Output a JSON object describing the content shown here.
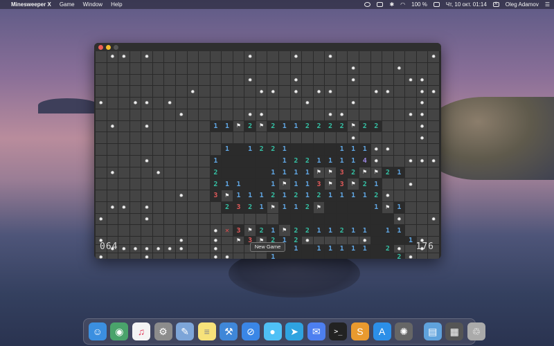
{
  "menubar": {
    "app": "Minesweeper X",
    "items": [
      "Game",
      "Window",
      "Help"
    ],
    "battery": "100 %",
    "datetime": "Чт, 10 окт.  01:14",
    "input_source": "A",
    "user": "Oleg Adamov"
  },
  "window": {
    "mines_left": "064",
    "new_game_label": "New Game",
    "timer": "176"
  },
  "board": {
    "legend": {
      ".": "hidden",
      "M": "mine",
      "F": "flag",
      "X": "wrong flag",
      " ": "revealed empty",
      "1-5": "revealed number"
    },
    "rows": [
      ".MM.M........M...M..M........M",
      "......................M...M...",
      ".............M...M....M....MM.",
      "........M.....MM.M.MM...MM..MM",
      "M..MM.M...........M...M.....M.",
      ".......M.....MM.....MM.....MM.",
      ".M..M.....11F2F2112222F22...M.",
      "......................M.....M.",
      "...........1 1221    111MM...",
      "....M.....1     12211114M..MMM",
      ".M...M....2    1111FF32FF21...",
      "..........211  1F113F3F21..M..",
      ".......M..3F1112121211112M....",
      ".MM.M......2321F112F    1F1...",
      "M...M...........          M..M",
      "..........MX3F21F2211211 11...",
      "M......M..M.F3F212M....M   1M.",
      ".MMMMMMM..M....  1 11111 2M.M.",
      "M...M.....MM...1          2M..",
      "...M...M.......M............M."
    ]
  },
  "dock": {
    "icons": [
      "finder-icon",
      "network-icon",
      "music-icon",
      "system-preferences-icon",
      "preview-icon",
      "notes-icon",
      "xcode-icon",
      "safari-icon",
      "messages-icon",
      "telegram-icon",
      "messenger-icon",
      "terminal-icon",
      "sublime-text-icon",
      "app-store-icon",
      "settings-icon",
      "folder-icon",
      "photos-icon",
      "trash-icon"
    ]
  },
  "colors": {
    "n1": "#61a8e6",
    "n2": "#35c0a4",
    "n3": "#e25a5a",
    "n4": "#9a86e0",
    "n5": "#e39b3a"
  }
}
